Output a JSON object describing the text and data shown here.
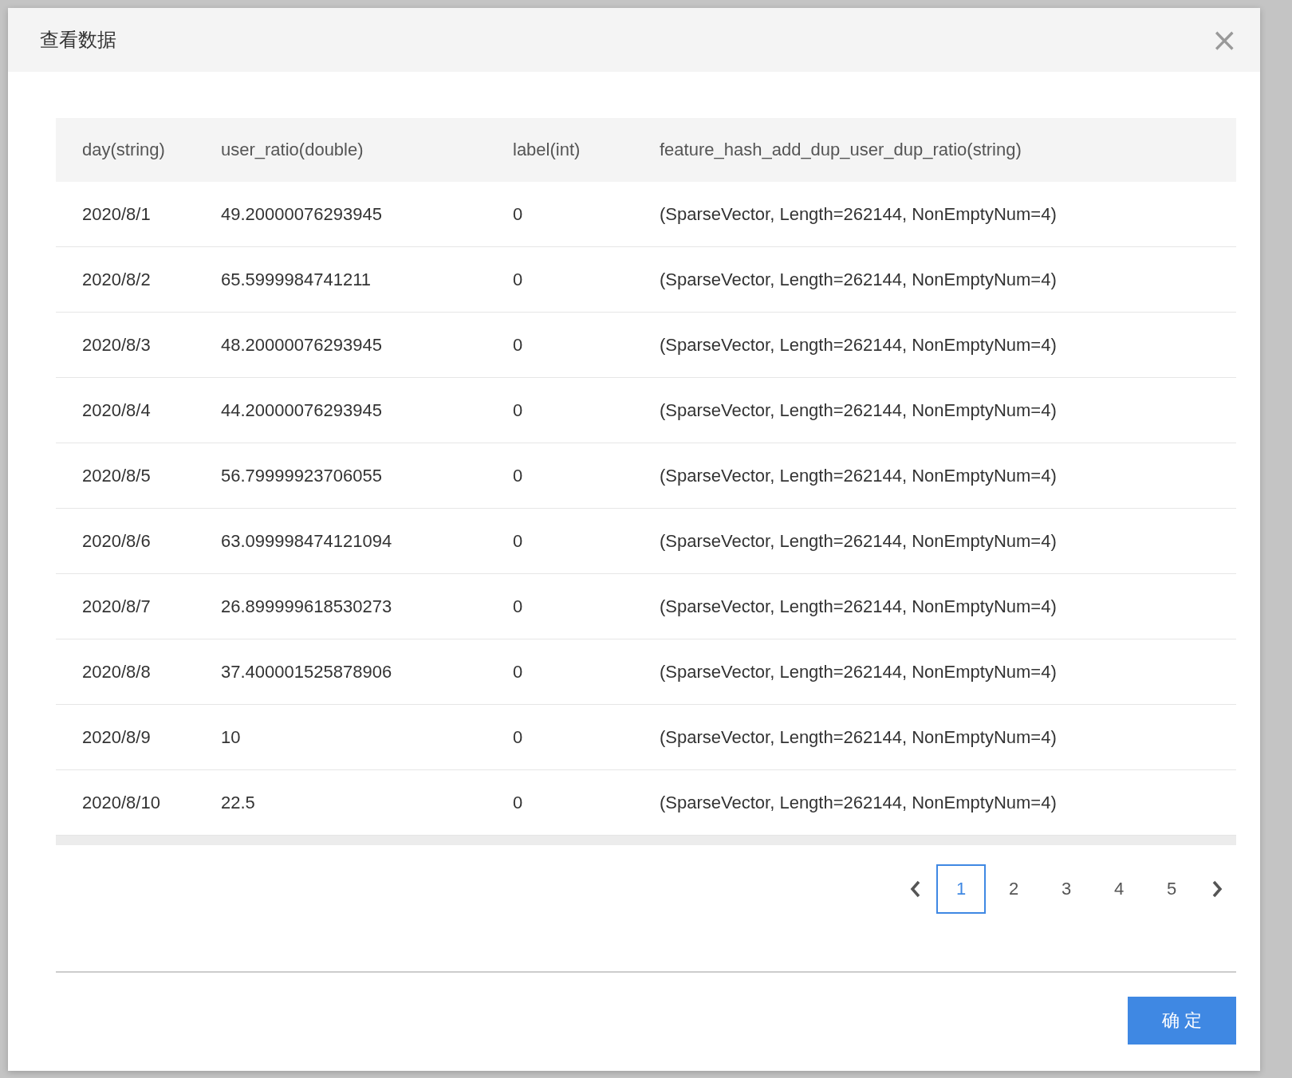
{
  "dialog": {
    "title": "查看数据",
    "close": "×"
  },
  "table": {
    "columns": [
      "day(string)",
      "user_ratio(double)",
      "label(int)",
      "feature_hash_add_dup_user_dup_ratio(string)"
    ],
    "rows": [
      [
        "2020/8/1",
        "49.20000076293945",
        "0",
        "(SparseVector, Length=262144, NonEmptyNum=4)"
      ],
      [
        "2020/8/2",
        "65.5999984741211",
        "0",
        "(SparseVector, Length=262144, NonEmptyNum=4)"
      ],
      [
        "2020/8/3",
        "48.20000076293945",
        "0",
        "(SparseVector, Length=262144, NonEmptyNum=4)"
      ],
      [
        "2020/8/4",
        "44.20000076293945",
        "0",
        "(SparseVector, Length=262144, NonEmptyNum=4)"
      ],
      [
        "2020/8/5",
        "56.79999923706055",
        "0",
        "(SparseVector, Length=262144, NonEmptyNum=4)"
      ],
      [
        "2020/8/6",
        "63.099998474121094",
        "0",
        "(SparseVector, Length=262144, NonEmptyNum=4)"
      ],
      [
        "2020/8/7",
        "26.899999618530273",
        "0",
        "(SparseVector, Length=262144, NonEmptyNum=4)"
      ],
      [
        "2020/8/8",
        "37.400001525878906",
        "0",
        "(SparseVector, Length=262144, NonEmptyNum=4)"
      ],
      [
        "2020/8/9",
        "10",
        "0",
        "(SparseVector, Length=262144, NonEmptyNum=4)"
      ],
      [
        "2020/8/10",
        "22.5",
        "0",
        "(SparseVector, Length=262144, NonEmptyNum=4)"
      ]
    ]
  },
  "pagination": {
    "pages": [
      {
        "label": "1",
        "selected": true
      },
      {
        "label": "2",
        "selected": false
      },
      {
        "label": "3",
        "selected": false
      },
      {
        "label": "4",
        "selected": false
      },
      {
        "label": "5",
        "selected": false
      }
    ]
  },
  "footer": {
    "confirm": "确 定"
  }
}
